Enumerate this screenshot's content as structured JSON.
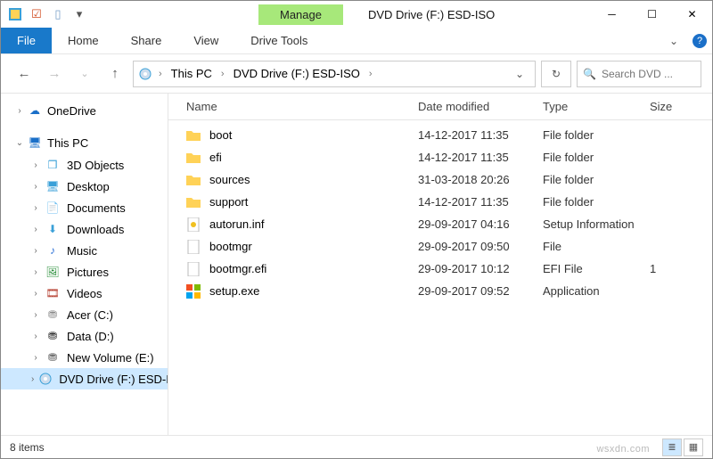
{
  "window": {
    "title": "DVD Drive (F:) ESD-ISO",
    "context_tab": "Manage"
  },
  "ribbon": {
    "file": "File",
    "tabs": [
      "Home",
      "Share",
      "View"
    ],
    "subtab": "Drive Tools"
  },
  "breadcrumb": {
    "items": [
      "This PC",
      "DVD Drive (F:) ESD-ISO"
    ]
  },
  "search": {
    "placeholder": "Search DVD ..."
  },
  "nav": {
    "onedrive": "OneDrive",
    "thispc": "This PC",
    "items": [
      {
        "label": "3D Objects",
        "icon": "cube",
        "color": "#3aa0d8"
      },
      {
        "label": "Desktop",
        "icon": "desktop",
        "color": "#3aa0d8"
      },
      {
        "label": "Documents",
        "icon": "doc",
        "color": "#3aa0d8"
      },
      {
        "label": "Downloads",
        "icon": "download",
        "color": "#3aa0d8"
      },
      {
        "label": "Music",
        "icon": "music",
        "color": "#2a6fd6"
      },
      {
        "label": "Pictures",
        "icon": "picture",
        "color": "#2a8f3a"
      },
      {
        "label": "Videos",
        "icon": "video",
        "color": "#b03020"
      },
      {
        "label": "Acer (C:)",
        "icon": "drive",
        "color": "#888"
      },
      {
        "label": "Data (D:)",
        "icon": "drive",
        "color": "#222"
      },
      {
        "label": "New Volume (E:)",
        "icon": "drive",
        "color": "#555"
      },
      {
        "label": "DVD Drive (F:) ESD-ISO",
        "icon": "dvd",
        "color": "#3aa0d8",
        "selected": true
      }
    ]
  },
  "columns": {
    "name": "Name",
    "date": "Date modified",
    "type": "Type",
    "size": "Size"
  },
  "files": [
    {
      "name": "boot",
      "date": "14-12-2017 11:35",
      "type": "File folder",
      "icon": "folder"
    },
    {
      "name": "efi",
      "date": "14-12-2017 11:35",
      "type": "File folder",
      "icon": "folder"
    },
    {
      "name": "sources",
      "date": "31-03-2018 20:26",
      "type": "File folder",
      "icon": "folder"
    },
    {
      "name": "support",
      "date": "14-12-2017 11:35",
      "type": "File folder",
      "icon": "folder"
    },
    {
      "name": "autorun.inf",
      "date": "29-09-2017 04:16",
      "type": "Setup Information",
      "icon": "inf"
    },
    {
      "name": "bootmgr",
      "date": "29-09-2017 09:50",
      "type": "File",
      "icon": "file"
    },
    {
      "name": "bootmgr.efi",
      "date": "29-09-2017 10:12",
      "type": "EFI File",
      "icon": "file",
      "size": "1"
    },
    {
      "name": "setup.exe",
      "date": "29-09-2017 09:52",
      "type": "Application",
      "icon": "exe"
    }
  ],
  "status": {
    "text": "8 items"
  },
  "watermark": "wsxdn.com"
}
